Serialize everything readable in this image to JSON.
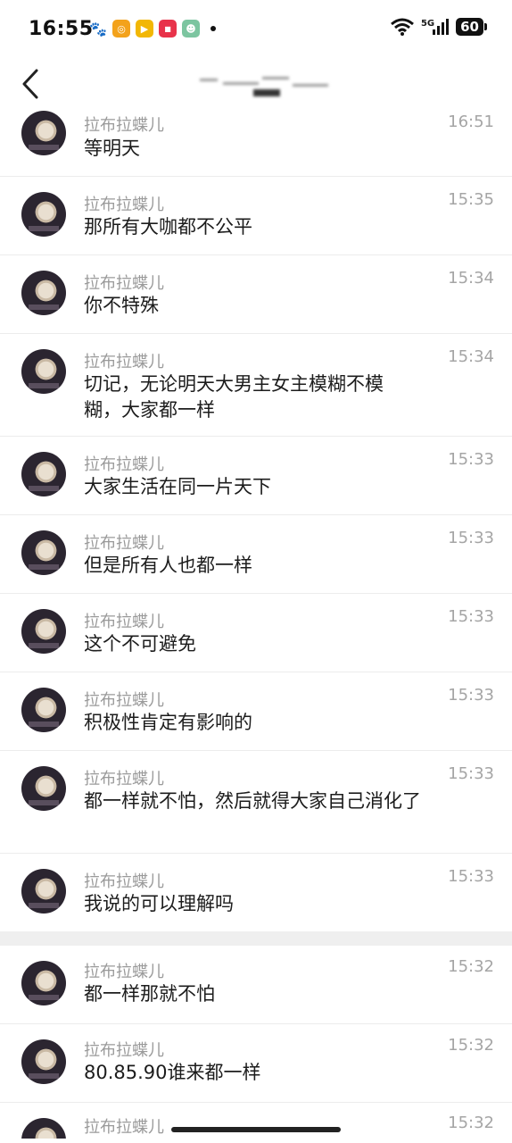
{
  "status_bar": {
    "time": "16:55",
    "network": "5G",
    "battery": "60"
  },
  "nav": {
    "back_label": "<"
  },
  "messages": [
    {
      "sender": "拉布拉蝶儿",
      "time": "16:51",
      "text": "等明天"
    },
    {
      "sender": "拉布拉蝶儿",
      "time": "15:35",
      "text": "那所有大咖都不公平"
    },
    {
      "sender": "拉布拉蝶儿",
      "time": "15:34",
      "text": "你不特殊"
    },
    {
      "sender": "拉布拉蝶儿",
      "time": "15:34",
      "text": "切记，无论明天大男主女主模糊不模糊，大家都一样"
    },
    {
      "sender": "拉布拉蝶儿",
      "time": "15:33",
      "text": "大家生活在同一片天下"
    },
    {
      "sender": "拉布拉蝶儿",
      "time": "15:33",
      "text": "但是所有人也都一样"
    },
    {
      "sender": "拉布拉蝶儿",
      "time": "15:33",
      "text": "这个不可避免"
    },
    {
      "sender": "拉布拉蝶儿",
      "time": "15:33",
      "text": "积极性肯定有影响的"
    },
    {
      "sender": "拉布拉蝶儿",
      "time": "15:33",
      "text": "都一样就不怕，然后就得大家自己消化了"
    },
    {
      "sender": "拉布拉蝶儿",
      "time": "15:33",
      "text": "我说的可以理解吗"
    },
    {
      "sender": "拉布拉蝶儿",
      "time": "15:32",
      "text": "都一样那就不怕"
    },
    {
      "sender": "拉布拉蝶儿",
      "time": "15:32",
      "text": "80.85.90谁来都一样"
    },
    {
      "sender": "拉布拉蝶儿",
      "time": "15:32",
      "text": ""
    }
  ]
}
